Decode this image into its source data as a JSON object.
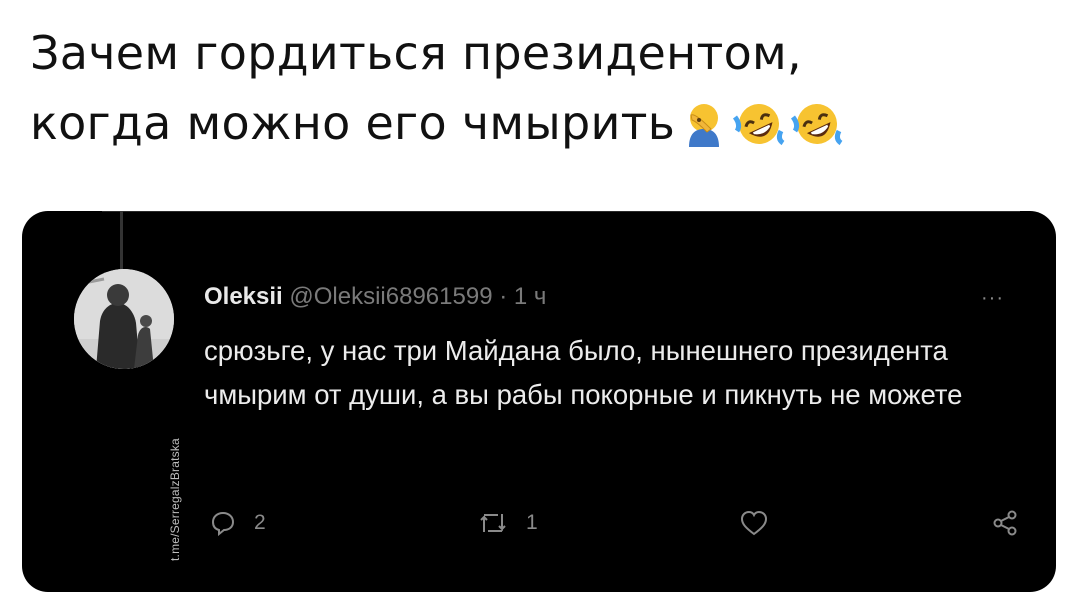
{
  "caption": {
    "line1": "Зачем гордиться президентом,",
    "line2": "когда можно его чмырить"
  },
  "tweet": {
    "author_name": "Oleksii",
    "handle": "@Oleksii68961599",
    "separator": "·",
    "time": "1 ч",
    "more": "···",
    "text": "срюзьге, у нас три Майдана было, нынешнего президента чмырим от души, а вы рабы покорные и пикнуть не можете",
    "replies": "2",
    "retweets": "1"
  },
  "watermark": "t.me/SerregalzBratska",
  "icons": {
    "caption_emoji": [
      "man-facepalming-emoji",
      "rolling-on-floor-laughing-emoji",
      "rolling-on-floor-laughing-emoji"
    ],
    "actions": [
      "reply-icon",
      "retweet-icon",
      "like-icon",
      "share-icon"
    ]
  },
  "colors": {
    "card_background": "#000000",
    "tweet_text": "#ececec",
    "muted_text": "#7a7a7a",
    "emoji_yellow": "#f7c331"
  }
}
